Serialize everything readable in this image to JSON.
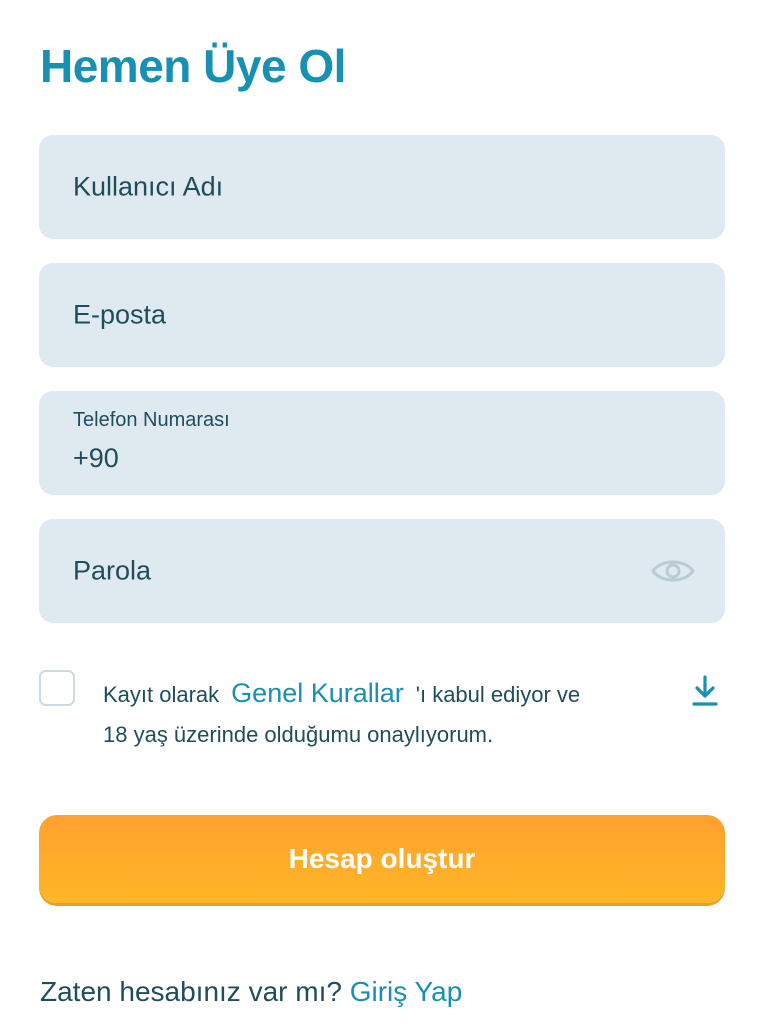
{
  "page": {
    "title": "Hemen Üye Ol"
  },
  "form": {
    "username": {
      "placeholder": "Kullanıcı Adı"
    },
    "email": {
      "placeholder": "E-posta"
    },
    "phone": {
      "label": "Telefon Numarası",
      "value": "+90"
    },
    "password": {
      "placeholder": "Parola",
      "icon": "eye-icon"
    },
    "consent": {
      "prefix": "Kayıt olarak",
      "link": "Genel Kurallar",
      "suffix": "'ı kabul ediyor ve",
      "line2": "18 yaş üzerinde olduğumu onaylıyorum.",
      "checked": false,
      "download_icon": "download-icon"
    },
    "submit_label": "Hesap oluştur"
  },
  "footer": {
    "question": "Zaten hesabınız var mı?",
    "login_link": "Giriş Yap"
  },
  "colors": {
    "accent": "#1890b4",
    "text": "#1f4d5c",
    "field_bg": "#dfe9f0",
    "button": "#ffa12f"
  }
}
